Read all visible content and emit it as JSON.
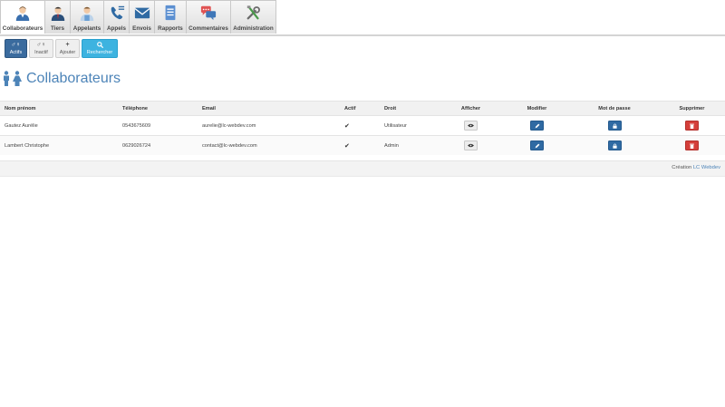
{
  "nav": {
    "tabs": [
      {
        "label": "Collaborateurs",
        "icon": "collaborator-icon",
        "active": true
      },
      {
        "label": "Tiers",
        "icon": "third-party-icon"
      },
      {
        "label": "Appelants",
        "icon": "caller-icon"
      },
      {
        "label": "Appels",
        "icon": "phone-icon"
      },
      {
        "label": "Envois",
        "icon": "envelope-icon"
      },
      {
        "label": "Rapports",
        "icon": "report-icon"
      },
      {
        "label": "Commentaires",
        "icon": "comments-icon"
      },
      {
        "label": "Administration",
        "icon": "tools-icon"
      }
    ]
  },
  "toolbar": {
    "actifs": "Actifs",
    "inactif": "Inactif",
    "ajouter": "Ajouter",
    "rechercher": "Rechercher"
  },
  "page": {
    "title": "Collaborateurs"
  },
  "table": {
    "headers": {
      "name": "Nom prénom",
      "phone": "Téléphone",
      "email": "Email",
      "active": "Actif",
      "role": "Droit",
      "view": "Afficher",
      "edit": "Modifier",
      "password": "Mot de passe",
      "delete": "Supprimer"
    },
    "rows": [
      {
        "name": "Gautez Aurélie",
        "phone": "0543675609",
        "email": "aurelie@lc-webdev.com",
        "active": true,
        "role": "Utilisateur"
      },
      {
        "name": "Lambert Christophe",
        "phone": "0629026724",
        "email": "contact@lc-webdev.com",
        "active": true,
        "role": "Admin"
      }
    ]
  },
  "footer": {
    "prefix": "Création",
    "link": "LC Webdev"
  },
  "colors": {
    "accent": "#4d84b8",
    "primary_button": "#2f6aa3",
    "danger_button": "#d43f3a",
    "search_button": "#3db3e0"
  }
}
